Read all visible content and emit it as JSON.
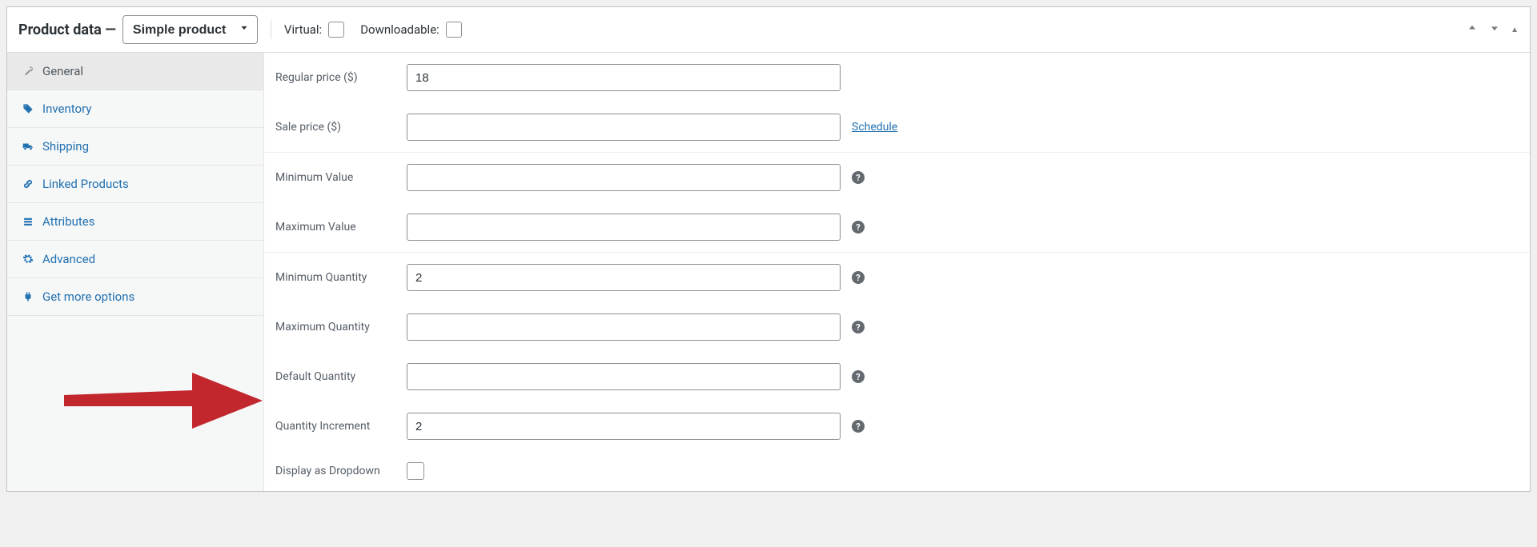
{
  "header": {
    "title": "Product data —",
    "product_type": "Simple product",
    "virtual_label": "Virtual:",
    "downloadable_label": "Downloadable:",
    "virtual_checked": false,
    "downloadable_checked": false
  },
  "sidebar": {
    "tabs": [
      {
        "id": "general",
        "label": "General",
        "icon": "wrench",
        "active": true
      },
      {
        "id": "inventory",
        "label": "Inventory",
        "icon": "tag",
        "active": false
      },
      {
        "id": "shipping",
        "label": "Shipping",
        "icon": "truck",
        "active": false
      },
      {
        "id": "linked-products",
        "label": "Linked Products",
        "icon": "link",
        "active": false
      },
      {
        "id": "attributes",
        "label": "Attributes",
        "icon": "list",
        "active": false
      },
      {
        "id": "advanced",
        "label": "Advanced",
        "icon": "gear",
        "active": false
      },
      {
        "id": "get-more",
        "label": "Get more options",
        "icon": "plug",
        "active": false
      }
    ]
  },
  "fields": {
    "regular_price": {
      "label": "Regular price ($)",
      "value": "18",
      "help": false,
      "link": ""
    },
    "sale_price": {
      "label": "Sale price ($)",
      "value": "",
      "help": false,
      "link": "Schedule"
    },
    "min_value": {
      "label": "Minimum Value",
      "value": "",
      "help": true,
      "link": ""
    },
    "max_value": {
      "label": "Maximum Value",
      "value": "",
      "help": true,
      "link": ""
    },
    "min_qty": {
      "label": "Minimum Quantity",
      "value": "2",
      "help": true,
      "link": ""
    },
    "max_qty": {
      "label": "Maximum Quantity",
      "value": "",
      "help": true,
      "link": ""
    },
    "default_qty": {
      "label": "Default Quantity",
      "value": "",
      "help": true,
      "link": ""
    },
    "qty_increment": {
      "label": "Quantity Increment",
      "value": "2",
      "help": true,
      "link": ""
    },
    "display_dropdown": {
      "label": "Display as Dropdown",
      "checked": false
    }
  }
}
